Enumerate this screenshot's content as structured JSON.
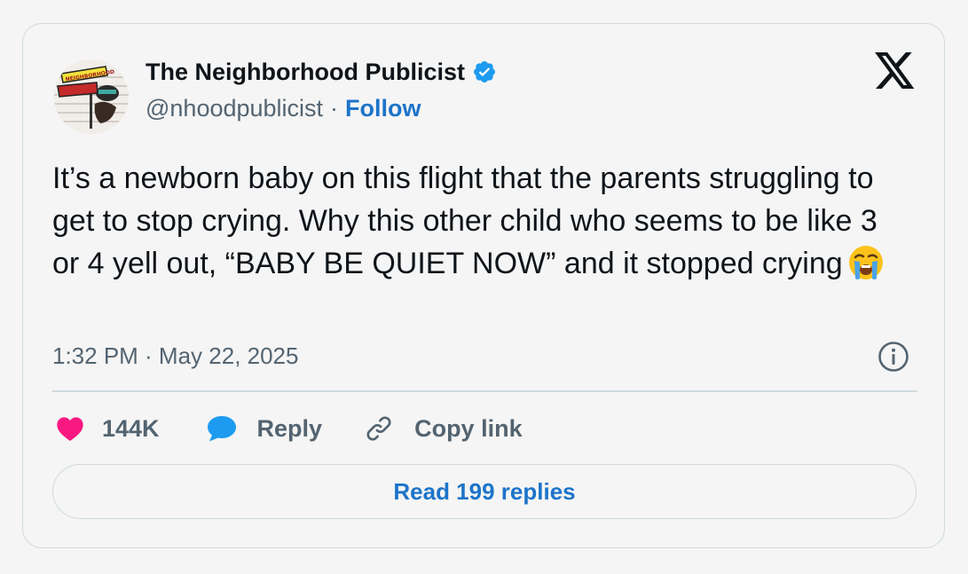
{
  "author": {
    "name": "The Neighborhood Publicist",
    "handle": "@nhoodpublicist",
    "separator": "·",
    "follow_label": "Follow",
    "avatar_icon": "street-sign-avatar-icon",
    "avatar_sign_text": "NEIGHBORHOOD",
    "verified_icon": "verified-badge-icon"
  },
  "brand": {
    "logo_icon": "x-logo-icon"
  },
  "tweet": {
    "text": "It’s a newborn baby on this flight that the parents struggling to get to stop crying. Why this other child who seems to be like 3 or 4 yell out, “BABY BE QUIET NOW” and it stopped crying",
    "emoji_icon": "loudly-crying-face-emoji",
    "timestamp": "1:32 PM · May 22, 2025",
    "info_icon": "info-icon"
  },
  "actions": {
    "likes_count": "144K",
    "like_icon": "heart-icon",
    "reply_label": "Reply",
    "reply_icon": "speech-bubble-icon",
    "copy_label": "Copy link",
    "copy_icon": "link-icon"
  },
  "footer": {
    "read_replies_label": "Read 199 replies"
  },
  "colors": {
    "background": "#f5f5f5",
    "border": "#cfd9de",
    "text_primary": "#0f1419",
    "text_secondary": "#536471",
    "link_blue": "#1d74c9",
    "verified_blue": "#1d9bf0",
    "like_pink": "#f91880"
  }
}
